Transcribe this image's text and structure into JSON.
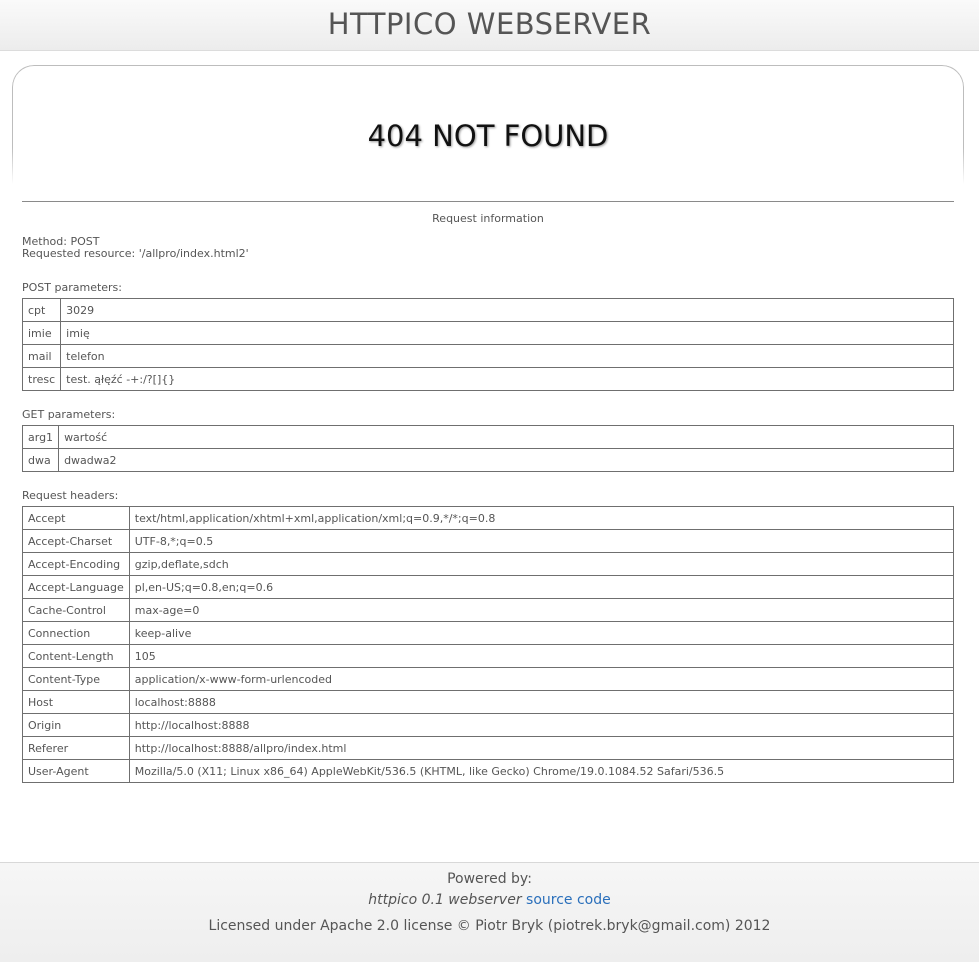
{
  "header": {
    "title": "HTTPICO WEBSERVER"
  },
  "status": {
    "message": "404 NOT FOUND"
  },
  "request_info": {
    "title": "Request information",
    "method_label": "Method:",
    "method": "POST",
    "resource_label": "Requested resource:",
    "resource": "'/allpro/index.html2'"
  },
  "post": {
    "title": "POST parameters:",
    "rows": [
      {
        "key": "cpt",
        "value": "3029"
      },
      {
        "key": "imie",
        "value": "imię"
      },
      {
        "key": "mail",
        "value": "telefon"
      },
      {
        "key": "tresc",
        "value": "test. ąłęźć -+:/?[]{}"
      }
    ]
  },
  "get": {
    "title": "GET parameters:",
    "rows": [
      {
        "key": "arg1",
        "value": "wartość"
      },
      {
        "key": "dwa",
        "value": "dwadwa2"
      }
    ]
  },
  "headers": {
    "title": "Request headers:",
    "rows": [
      {
        "key": "Accept",
        "value": "text/html,application/xhtml+xml,application/xml;q=0.9,*/*;q=0.8"
      },
      {
        "key": "Accept-Charset",
        "value": "UTF-8,*;q=0.5"
      },
      {
        "key": "Accept-Encoding",
        "value": "gzip,deflate,sdch"
      },
      {
        "key": "Accept-Language",
        "value": "pl,en-US;q=0.8,en;q=0.6"
      },
      {
        "key": "Cache-Control",
        "value": "max-age=0"
      },
      {
        "key": "Connection",
        "value": "keep-alive"
      },
      {
        "key": "Content-Length",
        "value": "105"
      },
      {
        "key": "Content-Type",
        "value": "application/x-www-form-urlencoded"
      },
      {
        "key": "Host",
        "value": "localhost:8888"
      },
      {
        "key": "Origin",
        "value": "http://localhost:8888"
      },
      {
        "key": "Referer",
        "value": "http://localhost:8888/allpro/index.html"
      },
      {
        "key": "User-Agent",
        "value": "Mozilla/5.0 (X11; Linux x86_64) AppleWebKit/536.5 (KHTML, like Gecko) Chrome/19.0.1084.52 Safari/536.5"
      }
    ]
  },
  "footer": {
    "powered_by": "Powered by:",
    "product": "httpico 0.1 webserver",
    "source_link": "source code",
    "license": "Licensed under Apache 2.0 license © Piotr Bryk (piotrek.bryk@gmail.com) 2012"
  }
}
